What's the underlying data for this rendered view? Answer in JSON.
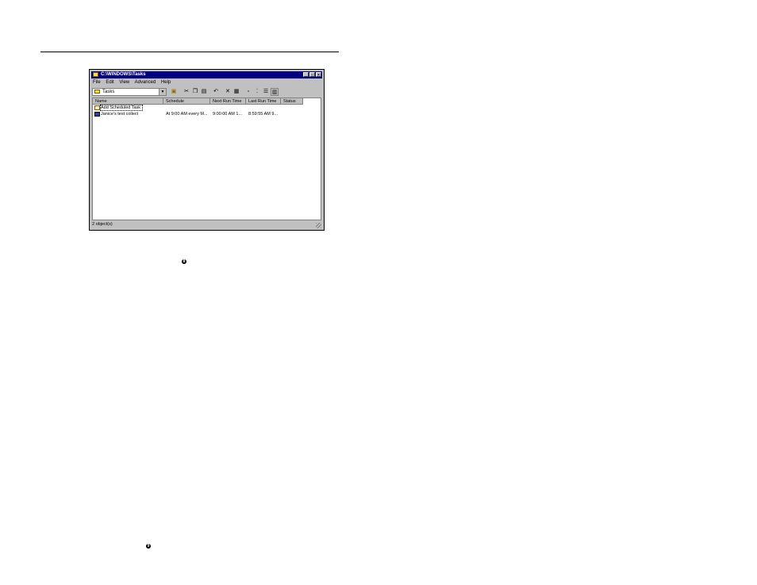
{
  "window": {
    "title": "C:\\WINDOWS\\Tasks",
    "controls": {
      "minimize": "_",
      "maximize": "□",
      "close": "×"
    }
  },
  "menu": [
    "File",
    "Edit",
    "View",
    "Advanced",
    "Help"
  ],
  "address": {
    "value": "Tasks"
  },
  "columns": [
    "Name",
    "Schedule",
    "Next Run Time",
    "Last Run Time",
    "Status"
  ],
  "rows": [
    {
      "name": "Add Scheduled Task",
      "schedule": "",
      "next_run": "",
      "last_run": "",
      "status": ""
    },
    {
      "name": "Janice's test collect",
      "schedule": "At 9:00 AM every M...",
      "next_run": "9:00:00 AM  1...",
      "last_run": "8:59:55 AM  9...",
      "status": ""
    }
  ],
  "status_bar": {
    "text": "2 object(s)"
  },
  "markers": {
    "first": "8",
    "second": "9"
  }
}
